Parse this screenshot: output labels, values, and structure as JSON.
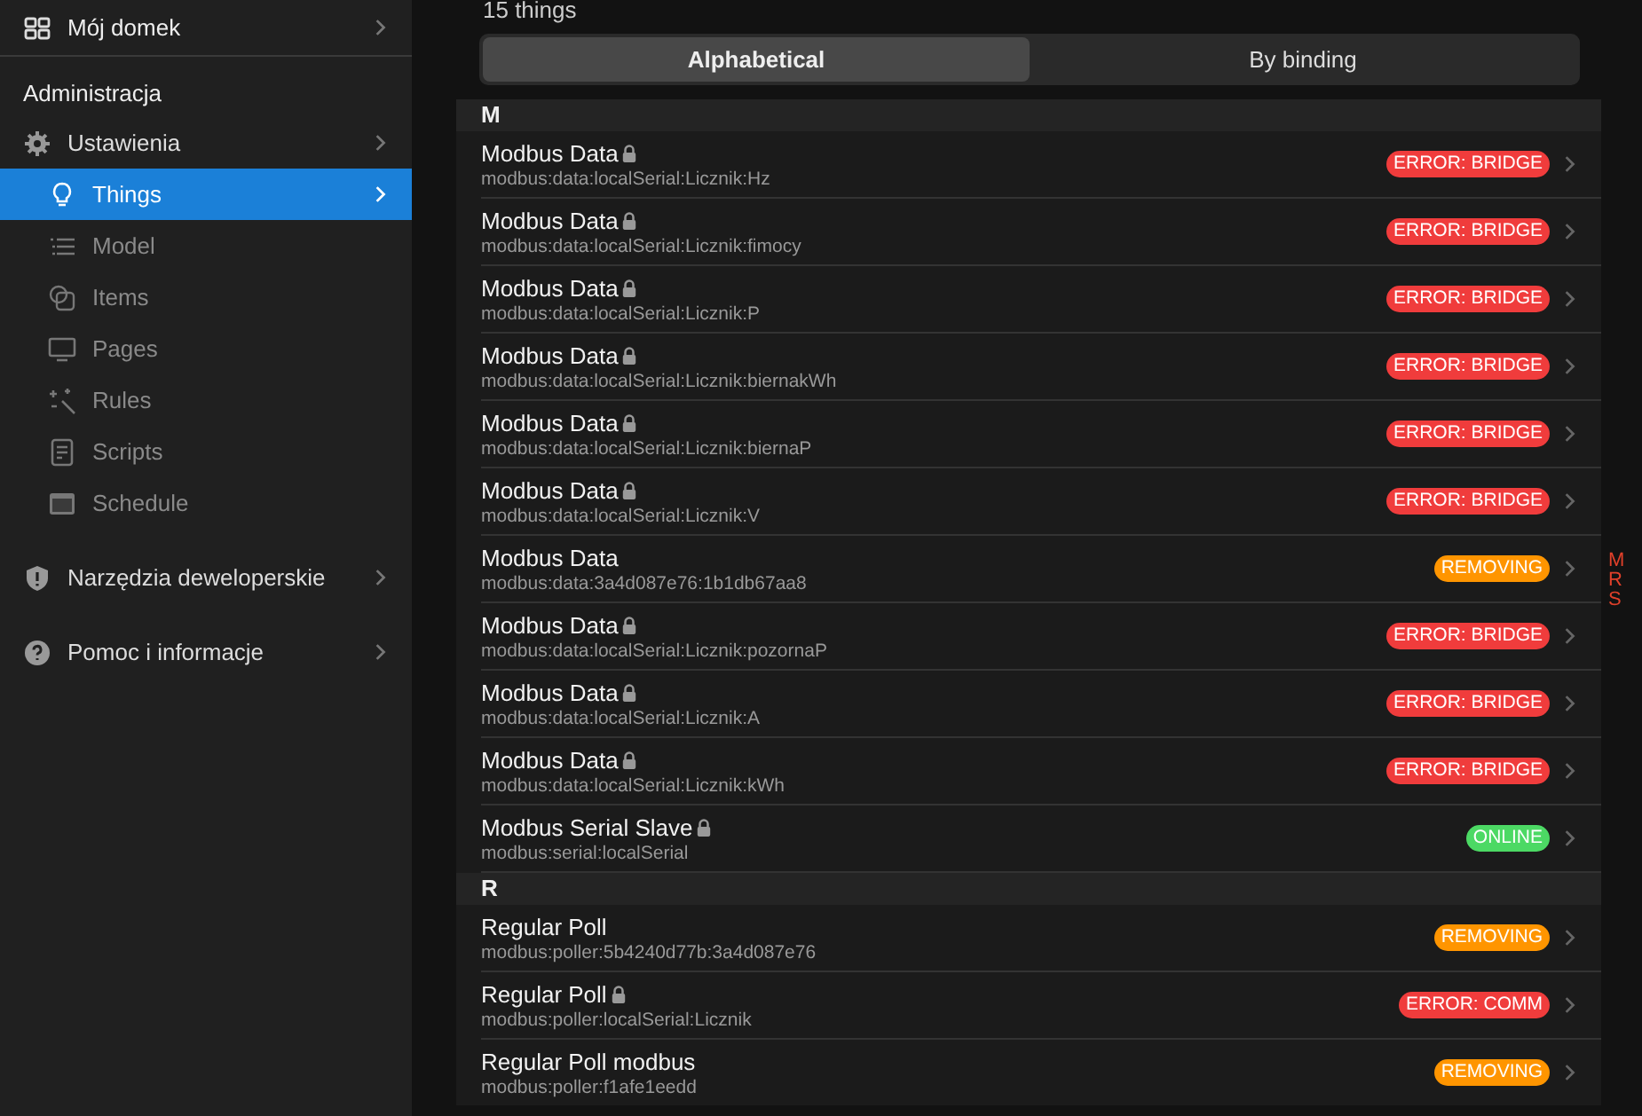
{
  "sidebar": {
    "top_item": {
      "label": "Mój domek"
    },
    "section_title": "Administracja",
    "items": [
      {
        "label": "Ustawienia",
        "kind": "section",
        "selected": false
      },
      {
        "label": "Things",
        "kind": "page",
        "selected": true
      },
      {
        "label": "Model",
        "kind": "page",
        "selected": false
      },
      {
        "label": "Items",
        "kind": "page",
        "selected": false
      },
      {
        "label": "Pages",
        "kind": "page",
        "selected": false
      },
      {
        "label": "Rules",
        "kind": "page",
        "selected": false
      },
      {
        "label": "Scripts",
        "kind": "page",
        "selected": false
      },
      {
        "label": "Schedule",
        "kind": "page",
        "selected": false
      },
      {
        "label": "Narzędzia deweloperskie",
        "kind": "section",
        "selected": false
      },
      {
        "label": "Pomoc i informacje",
        "kind": "section",
        "selected": false
      }
    ]
  },
  "count_text": "15 things",
  "tabs": [
    {
      "label": "Alphabetical",
      "selected": true
    },
    {
      "label": "By binding",
      "selected": false
    }
  ],
  "groups": [
    {
      "letter": "M",
      "things": [
        {
          "name": "Modbus Data",
          "locked": true,
          "uid": "modbus:data:localSerial:Licznik:Hz",
          "status": "ERROR: BRIDGE",
          "kind": "error"
        },
        {
          "name": "Modbus Data",
          "locked": true,
          "uid": "modbus:data:localSerial:Licznik:fimocy",
          "status": "ERROR: BRIDGE",
          "kind": "error"
        },
        {
          "name": "Modbus Data",
          "locked": true,
          "uid": "modbus:data:localSerial:Licznik:P",
          "status": "ERROR: BRIDGE",
          "kind": "error"
        },
        {
          "name": "Modbus Data",
          "locked": true,
          "uid": "modbus:data:localSerial:Licznik:biernakWh",
          "status": "ERROR: BRIDGE",
          "kind": "error"
        },
        {
          "name": "Modbus Data",
          "locked": true,
          "uid": "modbus:data:localSerial:Licznik:biernaP",
          "status": "ERROR: BRIDGE",
          "kind": "error"
        },
        {
          "name": "Modbus Data",
          "locked": true,
          "uid": "modbus:data:localSerial:Licznik:V",
          "status": "ERROR: BRIDGE",
          "kind": "error"
        },
        {
          "name": "Modbus Data",
          "locked": false,
          "uid": "modbus:data:3a4d087e76:1b1db67aa8",
          "status": "REMOVING",
          "kind": "warning"
        },
        {
          "name": "Modbus Data",
          "locked": true,
          "uid": "modbus:data:localSerial:Licznik:pozornaP",
          "status": "ERROR: BRIDGE",
          "kind": "error"
        },
        {
          "name": "Modbus Data",
          "locked": true,
          "uid": "modbus:data:localSerial:Licznik:A",
          "status": "ERROR: BRIDGE",
          "kind": "error"
        },
        {
          "name": "Modbus Data",
          "locked": true,
          "uid": "modbus:data:localSerial:Licznik:kWh",
          "status": "ERROR: BRIDGE",
          "kind": "error"
        },
        {
          "name": "Modbus Serial Slave",
          "locked": true,
          "uid": "modbus:serial:localSerial",
          "status": "ONLINE",
          "kind": "online"
        }
      ]
    },
    {
      "letter": "R",
      "things": [
        {
          "name": "Regular Poll",
          "locked": false,
          "uid": "modbus:poller:5b4240d77b:3a4d087e76",
          "status": "REMOVING",
          "kind": "warning"
        },
        {
          "name": "Regular Poll",
          "locked": true,
          "uid": "modbus:poller:localSerial:Licznik",
          "status": "ERROR: COMM",
          "kind": "error"
        },
        {
          "name": "Regular Poll modbus",
          "locked": false,
          "uid": "modbus:poller:f1afe1eedd",
          "status": "REMOVING",
          "kind": "warning"
        }
      ]
    }
  ],
  "edge_letters": [
    "M",
    "R",
    "S"
  ]
}
